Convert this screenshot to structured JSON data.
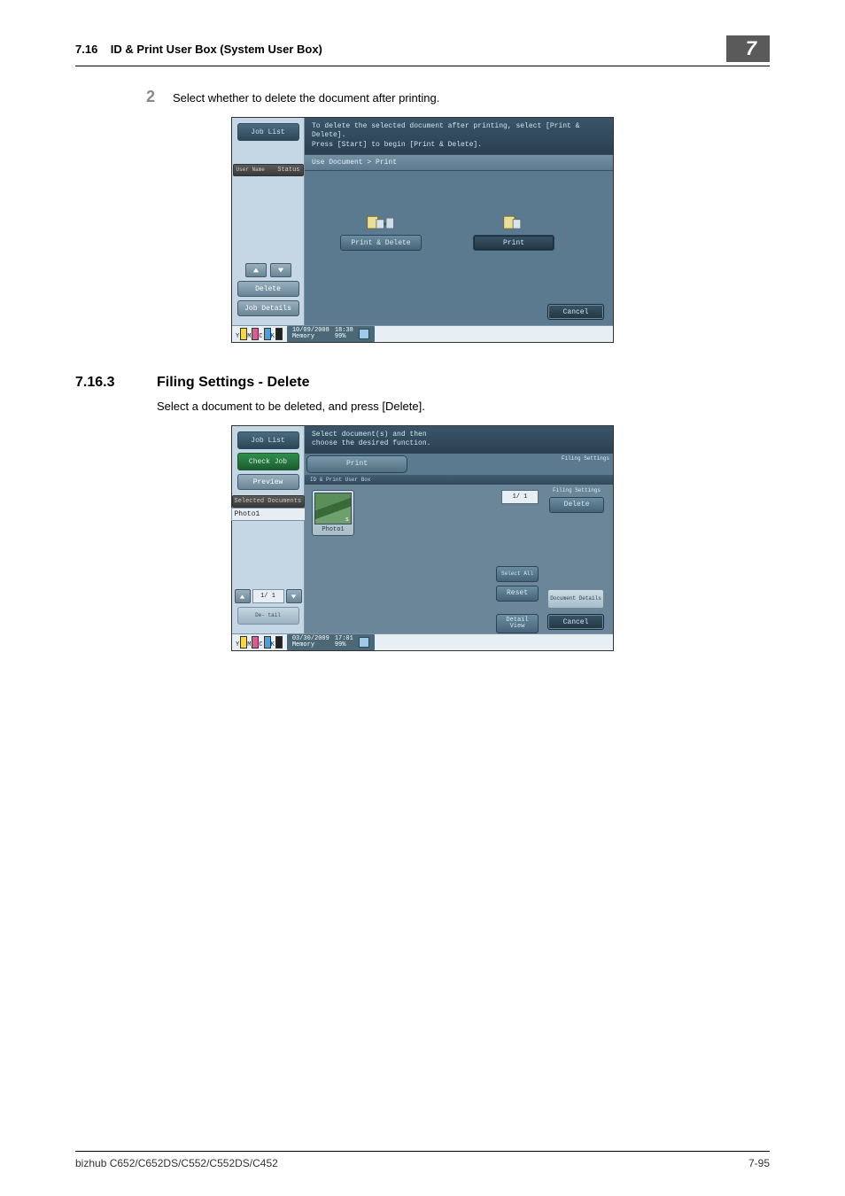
{
  "header": {
    "section_num": "7.16",
    "section_title": "ID & Print User Box (System User Box)",
    "chapter_num": "7"
  },
  "step2": {
    "number": "2",
    "text": "Select whether to delete the document after printing."
  },
  "panel1": {
    "job_list": "Job List",
    "user_name": "User Name",
    "status": "Status",
    "delete_btn": "Delete",
    "job_details": "Job Details",
    "message_l1": "To delete the selected document after printing, select [Print & Delete].",
    "message_l2": "Press [Start] to begin [Print & Delete].",
    "breadcrumb": "Use Document > Print",
    "print_delete": "Print & Delete",
    "print": "Print",
    "cancel": "Cancel",
    "date": "10/09/2008",
    "time": "18:38",
    "memory_label": "Memory",
    "memory_val": "99%"
  },
  "section_7_16_3": {
    "number": "7.16.3",
    "title": "Filing Settings - Delete",
    "body": "Select a document to be deleted, and press [Delete]."
  },
  "panel2": {
    "job_list": "Job List",
    "check_job": "Check Job",
    "preview": "Preview",
    "selected_docs": "Selected Documents",
    "photo1": "Photo1",
    "page": "1/  1",
    "detail_btn": "De- tail",
    "message": "Select document(s) and then choose the desired function.",
    "tab_print": "Print",
    "tab_filing": "Filing Settings",
    "subtab": "ID & Print User Box",
    "thumb_label": "Photo1",
    "right_page": "1/  1",
    "filing_settings": "Filing Settings",
    "delete": "Delete",
    "select_all": "Select All",
    "reset": "Reset",
    "detail_view": "Detail View",
    "doc_details": "Document Details",
    "cancel": "Cancel",
    "date": "03/30/2009",
    "time": "17:01",
    "memory_label": "Memory",
    "memory_val": "99%"
  },
  "footer": {
    "model": "bizhub C652/C652DS/C552/C552DS/C452",
    "page": "7-95"
  },
  "toner_labels": {
    "y": "Y",
    "m": "M",
    "c": "C",
    "k": "K"
  }
}
